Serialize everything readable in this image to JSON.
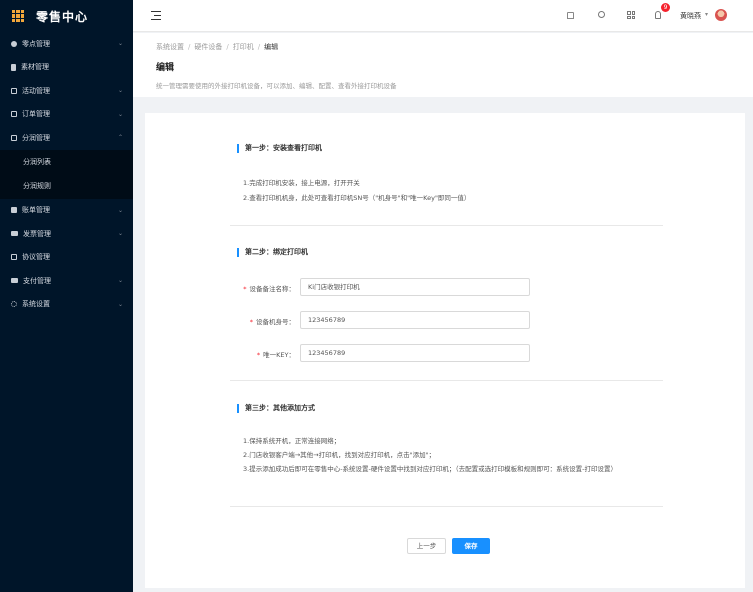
{
  "app": {
    "title": "零售中心"
  },
  "sidebar": {
    "items": [
      {
        "label": "零点管理",
        "icon": "user-icon",
        "has_children": true
      },
      {
        "label": "素材管理",
        "icon": "document-icon",
        "has_children": false
      },
      {
        "label": "活动管理",
        "icon": "calendar-icon",
        "has_children": true
      },
      {
        "label": "订单管理",
        "icon": "box-icon",
        "has_children": true
      },
      {
        "label": "分润管理",
        "icon": "monitor-icon",
        "has_children": true,
        "expanded": true
      },
      {
        "label": "账单管理",
        "icon": "bill-icon",
        "has_children": true
      },
      {
        "label": "发票管理",
        "icon": "invoice-icon",
        "has_children": true
      },
      {
        "label": "协议管理",
        "icon": "agreement-icon",
        "has_children": false
      },
      {
        "label": "支付管理",
        "icon": "card-icon",
        "has_children": true
      },
      {
        "label": "系统设置",
        "icon": "gear-icon",
        "has_children": true
      }
    ],
    "subitems": [
      {
        "label": "分润列表"
      },
      {
        "label": "分润规则"
      }
    ]
  },
  "header": {
    "badge_count": "9",
    "username": "黄晓燕"
  },
  "breadcrumb": {
    "items": [
      "系统设置",
      "硬件设备",
      "打印机"
    ],
    "current": "编辑"
  },
  "page": {
    "title": "编辑",
    "description": "统一管理需要使用的外接打印机设备，可以添加、编辑、配置、查看外接打印机设备"
  },
  "step1": {
    "title": "第一步：安装查看打印机",
    "lines": [
      "1.完成打印机安装，接上电源，打开开关",
      "2.查看打印机机身，此处可查看打印机SN号（\"机身号\"和\"唯一Key\"即同一值）"
    ]
  },
  "step2": {
    "title": "第二步：绑定打印机",
    "fields": [
      {
        "label": "设备备注名称：",
        "value": "Ki门店收银打印机"
      },
      {
        "label": "设备机身号：",
        "value": "123456789"
      },
      {
        "label": "唯一KEY：",
        "value": "123456789"
      }
    ]
  },
  "step3": {
    "title": "第三步：其他添加方式",
    "lines": [
      "1.保持系统开机，正常连接网络；",
      "2.门店收银客户端→其他→打印机，找到对应打印机，点击\"添加\"；",
      "3.提示添加成功后即可在零售中心-系统设置-硬件设置中找到对应打印机；（去配置或选打印模板和规则即可：系统设置-打印设置）"
    ]
  },
  "buttons": {
    "prev": "上一步",
    "save": "保存"
  },
  "colors": {
    "sidebar_bg": "#001529",
    "primary": "#1890ff",
    "required": "#f5222d",
    "logo_accent": "#f3a73b"
  }
}
